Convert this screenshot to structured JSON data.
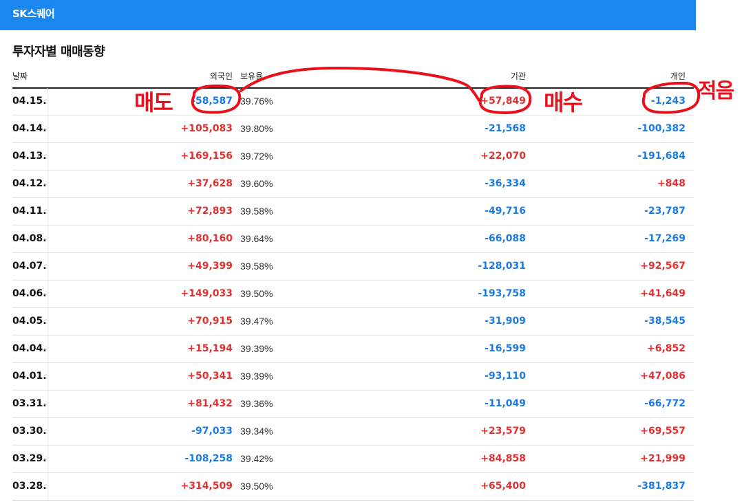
{
  "header": {
    "title": "SK스퀘어"
  },
  "section": {
    "title": "투자자별 매매동향"
  },
  "columns": {
    "date": "날짜",
    "foreign": "외국인",
    "holding": "보유율",
    "institution": "기관",
    "individual": "개인"
  },
  "rows": [
    {
      "date": "04.15.",
      "foreign": "-58,587",
      "holding": "39.76%",
      "institution": "+57,849",
      "individual": "-1,243"
    },
    {
      "date": "04.14.",
      "foreign": "+105,083",
      "holding": "39.80%",
      "institution": "-21,568",
      "individual": "-100,382"
    },
    {
      "date": "04.13.",
      "foreign": "+169,156",
      "holding": "39.72%",
      "institution": "+22,070",
      "individual": "-191,684"
    },
    {
      "date": "04.12.",
      "foreign": "+37,628",
      "holding": "39.60%",
      "institution": "-36,334",
      "individual": "+848"
    },
    {
      "date": "04.11.",
      "foreign": "+72,893",
      "holding": "39.58%",
      "institution": "-49,716",
      "individual": "-23,787"
    },
    {
      "date": "04.08.",
      "foreign": "+80,160",
      "holding": "39.64%",
      "institution": "-66,088",
      "individual": "-17,269"
    },
    {
      "date": "04.07.",
      "foreign": "+49,399",
      "holding": "39.58%",
      "institution": "-128,031",
      "individual": "+92,567"
    },
    {
      "date": "04.06.",
      "foreign": "+149,033",
      "holding": "39.50%",
      "institution": "-193,758",
      "individual": "+41,649"
    },
    {
      "date": "04.05.",
      "foreign": "+70,915",
      "holding": "39.47%",
      "institution": "-31,909",
      "individual": "-38,545"
    },
    {
      "date": "04.04.",
      "foreign": "+15,194",
      "holding": "39.39%",
      "institution": "-16,599",
      "individual": "+6,852"
    },
    {
      "date": "04.01.",
      "foreign": "+50,341",
      "holding": "39.39%",
      "institution": "-93,110",
      "individual": "+47,086"
    },
    {
      "date": "03.31.",
      "foreign": "+81,432",
      "holding": "39.36%",
      "institution": "-11,049",
      "individual": "-66,772"
    },
    {
      "date": "03.30.",
      "foreign": "-97,033",
      "holding": "39.34%",
      "institution": "+23,579",
      "individual": "+69,557"
    },
    {
      "date": "03.29.",
      "foreign": "-108,258",
      "holding": "39.42%",
      "institution": "+84,858",
      "individual": "+21,999"
    },
    {
      "date": "03.28.",
      "foreign": "+314,509",
      "holding": "39.50%",
      "institution": "+65,400",
      "individual": "-381,837"
    }
  ],
  "annotations": {
    "sell": "매도",
    "buy": "매수",
    "few": "적음"
  },
  "colors": {
    "topbar": "#1a86f0",
    "positive": "#e03030",
    "negative": "#1a7be5",
    "annotation": "#e8101a"
  }
}
